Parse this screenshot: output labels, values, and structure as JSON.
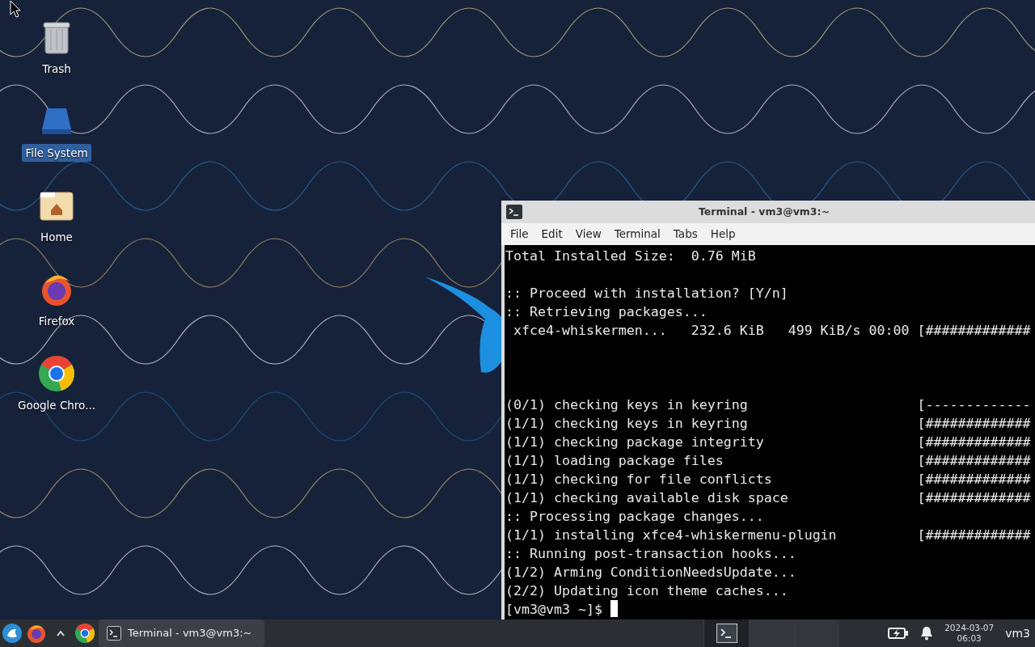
{
  "desktop_icons": [
    {
      "label": "Trash",
      "kind": "trash",
      "selected": false
    },
    {
      "label": "File System",
      "kind": "drive",
      "selected": true
    },
    {
      "label": "Home",
      "kind": "home",
      "selected": false
    },
    {
      "label": "Firefox",
      "kind": "firefox",
      "selected": false
    },
    {
      "label": "Google Chro...",
      "kind": "chrome",
      "selected": false
    }
  ],
  "terminal": {
    "title": "Terminal - vm3@vm3:~",
    "menu": [
      "File",
      "Edit",
      "View",
      "Terminal",
      "Tabs",
      "Help"
    ],
    "lines": [
      {
        "kind": "text",
        "text": "Total Installed Size:  0.76 MiB"
      },
      {
        "kind": "blank"
      },
      {
        "kind": "text",
        "text": ":: Proceed with installation? [Y/n]"
      },
      {
        "kind": "text",
        "text": ":: Retrieving packages..."
      },
      {
        "kind": "text",
        "text": " xfce4-whiskermen...   232.6 KiB   499 KiB/s 00:00 [#############"
      },
      {
        "kind": "blank"
      },
      {
        "kind": "blank"
      },
      {
        "kind": "blank"
      },
      {
        "kind": "text",
        "text": "(0/1) checking keys in keyring                     [-------------"
      },
      {
        "kind": "text",
        "text": "(1/1) checking keys in keyring                     [#############"
      },
      {
        "kind": "text",
        "text": "(1/1) checking package integrity                   [#############"
      },
      {
        "kind": "text",
        "text": "(1/1) loading package files                        [#############"
      },
      {
        "kind": "text",
        "text": "(1/1) checking for file conflicts                  [#############"
      },
      {
        "kind": "text",
        "text": "(1/1) checking available disk space                [#############"
      },
      {
        "kind": "text",
        "text": ":: Processing package changes..."
      },
      {
        "kind": "text",
        "text": "(1/1) installing xfce4-whiskermenu-plugin          [#############"
      },
      {
        "kind": "text",
        "text": ":: Running post-transaction hooks..."
      },
      {
        "kind": "text",
        "text": "(1/2) Arming ConditionNeedsUpdate..."
      },
      {
        "kind": "text",
        "text": "(2/2) Updating icon theme caches..."
      }
    ],
    "prompt": "[vm3@vm3 ~]$"
  },
  "taskbar": {
    "launchers": [
      {
        "kind": "menu"
      },
      {
        "kind": "firefox"
      },
      {
        "kind": "chevron"
      },
      {
        "kind": "chrome"
      }
    ],
    "tasks": [
      {
        "label": "Terminal - vm3@vm3:~",
        "selected": true
      }
    ],
    "workspaces": [
      {
        "selected": true,
        "has_window": true
      },
      {
        "selected": false,
        "has_window": false
      },
      {
        "selected": false,
        "has_window": false
      }
    ],
    "clock": {
      "date": "2024-03-07",
      "time": "06:03"
    },
    "user": "vm3"
  }
}
